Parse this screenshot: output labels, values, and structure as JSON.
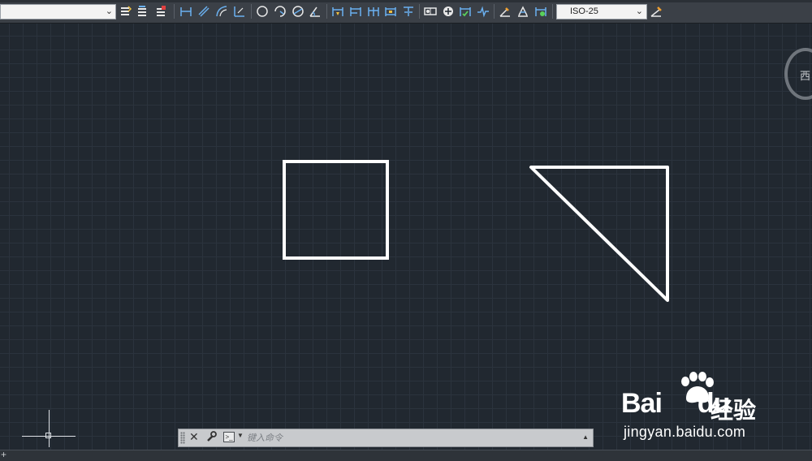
{
  "toolbar": {
    "layer_dropdown_value": "",
    "dimension_style": "ISO-25",
    "icons": [
      "layer-properties-icon",
      "layer-state-icon",
      "layer-previous-icon",
      "linear-dimension-icon",
      "aligned-dimension-icon",
      "arc-length-icon",
      "ordinate-dimension-icon",
      "radius-dimension-icon",
      "jogged-dimension-icon",
      "diameter-dimension-icon",
      "angular-dimension-icon",
      "quick-dimension-icon",
      "baseline-dimension-icon",
      "continue-dimension-icon",
      "dimension-space-icon",
      "dimension-break-icon",
      "tolerance-icon",
      "center-mark-icon",
      "inspection-icon",
      "jogged-linear-icon",
      "dimension-edit-icon",
      "dimension-text-edit-icon",
      "dimension-update-icon",
      "dimension-style-icon"
    ]
  },
  "viewcube": {
    "label": "西"
  },
  "command_line": {
    "placeholder": "键入命令",
    "close_icon": "close-icon",
    "customize_icon": "wrench-icon",
    "prompt_icon": "command-prompt-icon"
  },
  "watermark": {
    "logo_text": "Bai",
    "logo_du": "du",
    "jingyan": "经验",
    "url": "jingyan.baidu.com"
  },
  "colors": {
    "background": "#212830",
    "geometry": "#ffffff",
    "toolbar": "#3b4047"
  }
}
